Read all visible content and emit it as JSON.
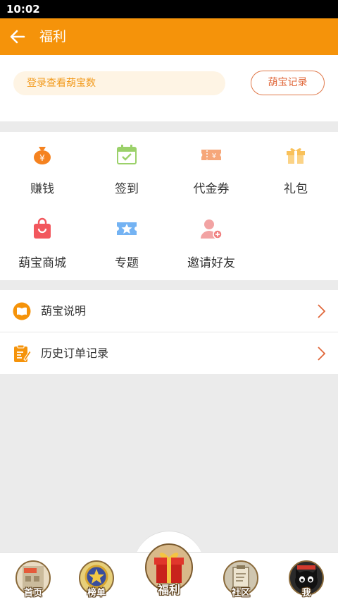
{
  "status_bar": {
    "time": "10:02"
  },
  "app_bar": {
    "title": "福利"
  },
  "login": {
    "prompt": "登录查看葫宝数",
    "records_button": "葫宝记录"
  },
  "grid": {
    "items": [
      {
        "label": "赚钱",
        "icon": "money-bag-icon",
        "color": "#f5821f"
      },
      {
        "label": "签到",
        "icon": "calendar-check-icon",
        "color": "#9bd16a"
      },
      {
        "label": "代金券",
        "icon": "voucher-icon",
        "color": "#f6a77a"
      },
      {
        "label": "礼包",
        "icon": "gift-box-icon",
        "color": "#f9c15a"
      },
      {
        "label": "葫宝商城",
        "icon": "shopping-bag-icon",
        "color": "#f2575d"
      },
      {
        "label": "专题",
        "icon": "ticket-star-icon",
        "color": "#74b3f3"
      },
      {
        "label": "邀请好友",
        "icon": "add-friend-icon",
        "color": "#f2a3a3"
      }
    ]
  },
  "list": {
    "items": [
      {
        "label": "葫宝说明",
        "icon": "book-icon"
      },
      {
        "label": "历史订单记录",
        "icon": "order-list-icon"
      }
    ]
  },
  "tab_bar": {
    "tabs": [
      {
        "label": "首页",
        "icon": "home-tab-icon"
      },
      {
        "label": "榜单",
        "icon": "ranking-badge-icon"
      },
      {
        "label": "福利",
        "icon": "gift-tab-icon",
        "active": true
      },
      {
        "label": "社区",
        "icon": "community-tab-icon"
      },
      {
        "label": "我",
        "icon": "profile-cat-icon"
      }
    ]
  },
  "colors": {
    "primary": "#f5930a",
    "accent_text": "#e0673a",
    "background": "#ebebeb"
  }
}
